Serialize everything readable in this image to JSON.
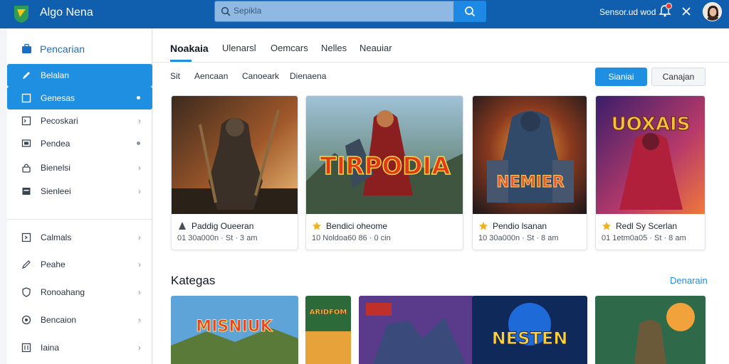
{
  "app": {
    "title": "Algo Nena"
  },
  "search": {
    "placeholder": "Sepikla"
  },
  "topbar": {
    "link": "Sensor.ud wod"
  },
  "sidebar": {
    "header": "Pencarian",
    "items": [
      {
        "label": "Belalan",
        "icon": "edit-icon"
      },
      {
        "label": "Genesas",
        "icon": "square-icon"
      },
      {
        "label": "Pecoskari",
        "icon": "terminal-icon"
      },
      {
        "label": "Pendea",
        "icon": "monitor-icon"
      },
      {
        "label": "Bienelsi",
        "icon": "lock-icon"
      },
      {
        "label": "Sienleei",
        "icon": "image-icon"
      },
      {
        "label": "Calmals",
        "icon": "export-icon"
      },
      {
        "label": "Peahe",
        "icon": "pencil-icon"
      },
      {
        "label": "Ronoahang",
        "icon": "shield-icon"
      },
      {
        "label": "Bencaion",
        "icon": "badge-icon"
      },
      {
        "label": "Iaina",
        "icon": "grid-icon"
      }
    ]
  },
  "tabs": [
    "Noakaia",
    "Ulenarsl",
    "Oemcars",
    "Nelles",
    "Neauiar"
  ],
  "filters": [
    "Sit",
    "Aencaan",
    "Canoeark",
    "Dienaena"
  ],
  "buttons": {
    "primary": "Sianiai",
    "secondary": "Canajan"
  },
  "cards": [
    {
      "title": "Paddig Oueeran",
      "meta": "01  30a000n  ·  St  ·  3 am"
    },
    {
      "title": "Bendici oheome",
      "meta": "10  Noldoa60  86  ·  0 cin"
    },
    {
      "title": "Pendio lsanan",
      "meta": "10  30a000n  ·  St  ·  8 am"
    },
    {
      "title": "Redl Sy Scerlan",
      "meta": "01  1etm0a05  ·  St  ·  8 am"
    }
  ],
  "card_art_text": [
    "TIRPODIA",
    "NEMIER",
    "UOXAIS"
  ],
  "section": {
    "title": "Kategas",
    "link": "Denarain"
  },
  "thumb_art_text": [
    "MISNIUK",
    "ARIDFOM",
    "NESTEN"
  ],
  "colors": {
    "topbar": "#0f5fae",
    "accent": "#1e8fe1",
    "badge": "#e53935"
  }
}
